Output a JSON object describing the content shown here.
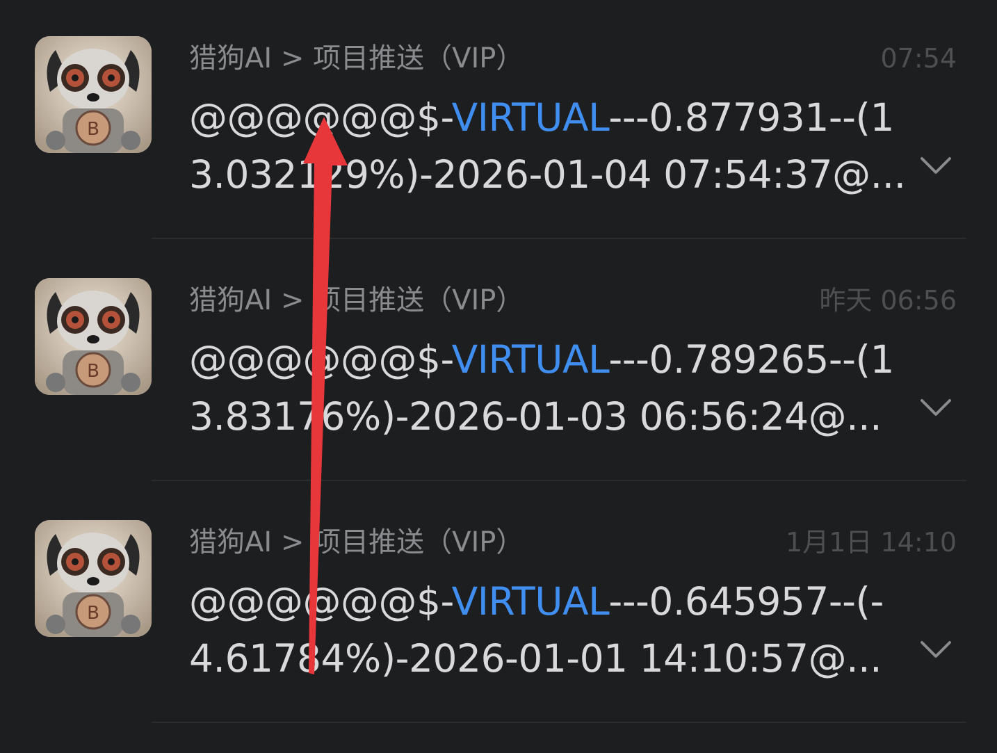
{
  "messages": [
    {
      "sender": "猎狗AI > 项目推送（VIP）",
      "time": "07:54",
      "body_prefix": "@@@@@@$-",
      "body_highlight": "VIRTUAL",
      "body_suffix": "---0.877931--(13.032129%)-2026-01-04 07:54:37@...",
      "avatar_icon": "robot-dog-bitcoin-avatar",
      "expand_icon": "chevron-down-icon"
    },
    {
      "sender": "猎狗AI > 项目推送（VIP）",
      "time": "昨天 06:56",
      "body_prefix": "@@@@@@$-",
      "body_highlight": "VIRTUAL",
      "body_suffix": "---0.789265--(13.83176%)-2026-01-03 06:56:24@...",
      "avatar_icon": "robot-dog-bitcoin-avatar",
      "expand_icon": "chevron-down-icon"
    },
    {
      "sender": "猎狗AI > 项目推送（VIP）",
      "time": "1月1日 14:10",
      "body_prefix": "@@@@@@$-",
      "body_highlight": "VIRTUAL",
      "body_suffix": "---0.645957--(-4.61784%)-2026-01-01 14:10:57@...",
      "avatar_icon": "robot-dog-bitcoin-avatar",
      "expand_icon": "chevron-down-icon"
    }
  ],
  "colors": {
    "background": "#1d1e20",
    "highlight": "#3f8ef0",
    "annotation_arrow": "#e8373a"
  },
  "annotation": {
    "icon": "red-arrow-up-icon"
  }
}
